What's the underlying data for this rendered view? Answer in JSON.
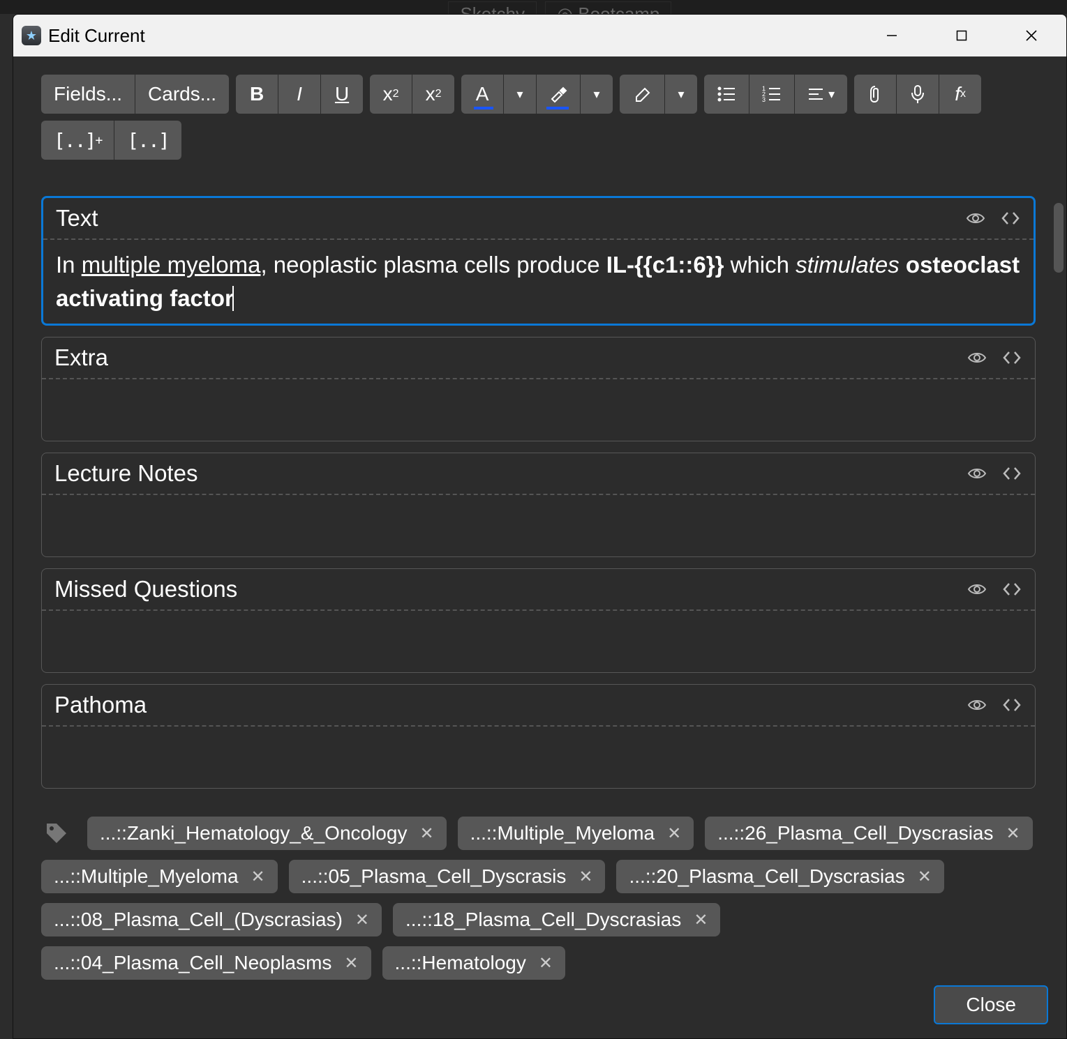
{
  "bg_tabs": [
    "Sketchy",
    "Bootcamp"
  ],
  "window": {
    "title": "Edit Current"
  },
  "toolbar": {
    "fields_btn": "Fields...",
    "cards_btn": "Cards..."
  },
  "fields": [
    {
      "label": "Text",
      "focused": true,
      "content_segments": [
        {
          "t": "In ",
          "fmt": ""
        },
        {
          "t": "multiple myeloma",
          "fmt": "ul"
        },
        {
          "t": ", neoplastic plasma cells produce ",
          "fmt": ""
        },
        {
          "t": "IL-{{c1::6}}",
          "fmt": "bold"
        },
        {
          "t": " which ",
          "fmt": ""
        },
        {
          "t": "stimulates",
          "fmt": "it"
        },
        {
          "t": " ",
          "fmt": ""
        },
        {
          "t": "osteoclast activating factor",
          "fmt": "bold"
        }
      ]
    },
    {
      "label": "Extra",
      "focused": false,
      "content_segments": []
    },
    {
      "label": "Lecture Notes",
      "focused": false,
      "content_segments": []
    },
    {
      "label": "Missed Questions",
      "focused": false,
      "content_segments": []
    },
    {
      "label": "Pathoma",
      "focused": false,
      "content_segments": []
    }
  ],
  "tags": [
    "...::Zanki_Hematology_&_Oncology",
    "...::Multiple_Myeloma",
    "...::26_Plasma_Cell_Dyscrasias",
    "...::Multiple_Myeloma",
    "...::05_Plasma_Cell_Dyscrasis",
    "...::20_Plasma_Cell_Dyscrasias",
    "...::08_Plasma_Cell_(Dyscrasias)",
    "...::18_Plasma_Cell_Dyscrasias",
    "...::04_Plasma_Cell_Neoplasms",
    "...::Hematology"
  ],
  "footer": {
    "close": "Close"
  }
}
